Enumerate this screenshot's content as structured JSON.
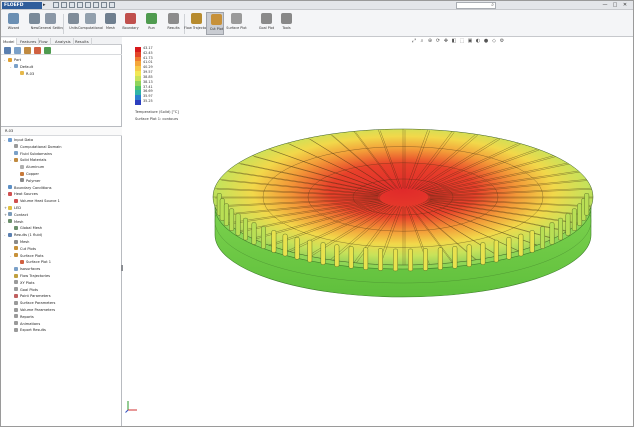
{
  "app": {
    "logo_text": "FLOEFD",
    "file_title": "",
    "window_controls": [
      "—",
      "□",
      "✕"
    ]
  },
  "ribbon": {
    "buttons": [
      {
        "label": "Wizard",
        "icon": "wizard-icon",
        "color": "#6b8fb3"
      },
      {
        "label": "New",
        "icon": "new-file-icon",
        "color": "#7a8a99"
      },
      {
        "label": "General Settings",
        "icon": "settings-icon",
        "color": "#8a97a6"
      },
      {
        "label": "Units",
        "icon": "units-icon",
        "color": "#7f8c99"
      },
      {
        "label": "Computational Domain",
        "icon": "domain-icon",
        "color": "#92a0ad"
      },
      {
        "label": "Mesh",
        "icon": "mesh-icon",
        "color": "#6f7f8f"
      },
      {
        "label": "Boundary",
        "icon": "boundary-icon",
        "color": "#c0504d"
      },
      {
        "label": "Run",
        "icon": "run-icon",
        "color": "#4f9b4f"
      },
      {
        "label": "Results",
        "icon": "results-icon",
        "color": "#8c8c8c"
      },
      {
        "label": "Flow Trajectories",
        "icon": "flow-trajectories-icon",
        "color": "#b78b2e"
      },
      {
        "label": "Cut Plot",
        "icon": "cut-plot-icon",
        "color": "#c7913a"
      },
      {
        "label": "Surface Plot",
        "icon": "surface-plot-icon",
        "color": "#9a9a9a"
      },
      {
        "label": "Goal Plot",
        "icon": "goal-plot-icon",
        "color": "#8a8a8a"
      },
      {
        "label": "Tools",
        "icon": "tools-icon",
        "color": "#888888"
      }
    ]
  },
  "sidebar": {
    "tabs": [
      "Model",
      "Features",
      "Flow",
      "Analysis",
      "Results"
    ],
    "tree1": [
      {
        "label": "Part",
        "level": 0,
        "icon_color": "#e0a030",
        "exp": "-"
      },
      {
        "label": "Default",
        "level": 1,
        "icon_color": "#7aa0c8",
        "exp": "-"
      },
      {
        "label": "R-03",
        "level": 2,
        "icon_color": "#e6b84a",
        "exp": ""
      }
    ],
    "tree2_header": "R-03",
    "tree2": [
      {
        "label": "Input Data",
        "level": 0,
        "icon_color": "#6b9bd1",
        "exp": "-"
      },
      {
        "label": "Computational Domain",
        "level": 1,
        "icon_color": "#9a9a9a",
        "exp": ""
      },
      {
        "label": "Fluid Subdomains",
        "level": 1,
        "icon_color": "#7aa0c8",
        "exp": ""
      },
      {
        "label": "Solid Materials",
        "level": 1,
        "icon_color": "#c08a40",
        "exp": "-"
      },
      {
        "label": "Aluminum",
        "level": 2,
        "icon_color": "#b0b0b0",
        "exp": ""
      },
      {
        "label": "Copper",
        "level": 2,
        "icon_color": "#c87a3a",
        "exp": ""
      },
      {
        "label": "Polymer",
        "level": 2,
        "icon_color": "#8a8a8a",
        "exp": ""
      },
      {
        "label": "Boundary Conditions",
        "level": 0,
        "icon_color": "#5c8fc5",
        "exp": ""
      },
      {
        "label": "Heat Sources",
        "level": 0,
        "icon_color": "#d05050",
        "exp": "-"
      },
      {
        "label": "Volume Heat Source 1",
        "level": 1,
        "icon_color": "#d05050",
        "exp": ""
      },
      {
        "label": "LED",
        "level": 0,
        "icon_color": "#e0c040",
        "exp": "+"
      },
      {
        "label": "Contact",
        "level": 0,
        "icon_color": "#7a9ab8",
        "exp": "+"
      },
      {
        "label": "Mesh",
        "level": 0,
        "icon_color": "#6a8f6a",
        "exp": "-"
      },
      {
        "label": "Global Mesh",
        "level": 1,
        "icon_color": "#6a8f6a",
        "exp": ""
      },
      {
        "label": "Results (1 fluid)",
        "level": 0,
        "icon_color": "#5a7fb0",
        "exp": "-"
      },
      {
        "label": "Mesh",
        "level": 1,
        "icon_color": "#8a8a8a",
        "exp": ""
      },
      {
        "label": "Cut Plots",
        "level": 1,
        "icon_color": "#c7913a",
        "exp": ""
      },
      {
        "label": "Surface Plots",
        "level": 1,
        "icon_color": "#c7913a",
        "exp": "-"
      },
      {
        "label": "Surface Plot 1",
        "level": 2,
        "icon_color": "#d06040",
        "exp": ""
      },
      {
        "label": "Isosurfaces",
        "level": 1,
        "icon_color": "#7aa0c8",
        "exp": ""
      },
      {
        "label": "Flow Trajectories",
        "level": 1,
        "icon_color": "#c0a040",
        "exp": ""
      },
      {
        "label": "XY Plots",
        "level": 1,
        "icon_color": "#9a9a9a",
        "exp": ""
      },
      {
        "label": "Goal Plots",
        "level": 1,
        "icon_color": "#9a9a9a",
        "exp": ""
      },
      {
        "label": "Point Parameters",
        "level": 1,
        "icon_color": "#c06060",
        "exp": ""
      },
      {
        "label": "Surface Parameters",
        "level": 1,
        "icon_color": "#9a9a9a",
        "exp": ""
      },
      {
        "label": "Volume Parameters",
        "level": 1,
        "icon_color": "#9a9a9a",
        "exp": ""
      },
      {
        "label": "Reports",
        "level": 1,
        "icon_color": "#9a9a9a",
        "exp": ""
      },
      {
        "label": "Animations",
        "level": 1,
        "icon_color": "#9a9a9a",
        "exp": ""
      },
      {
        "label": "Export Results",
        "level": 1,
        "icon_color": "#9a9a9a",
        "exp": ""
      }
    ]
  },
  "viewport": {
    "legend": {
      "ticks": [
        "43.17",
        "42.45",
        "41.73",
        "41.01",
        "40.29",
        "39.57",
        "38.85",
        "38.13",
        "37.41",
        "36.69",
        "35.97",
        "35.25"
      ],
      "colors": [
        "#d7191c",
        "#e3452a",
        "#ee7a2f",
        "#f4a63a",
        "#f7c948",
        "#f2e755",
        "#c9e35a",
        "#8fd45b",
        "#4fc46a",
        "#2fb5a8",
        "#2a7fd0",
        "#2b3fbf"
      ],
      "quantity_label": "Temperature (Solid) [°C]",
      "plot_label": "Surface Plot 1: contours"
    },
    "toolbar_icons": [
      "zoom-fit-icon",
      "zoom-area-icon",
      "zoom-icon",
      "rotate-icon",
      "pan-icon",
      "section-icon",
      "view-orient-icon",
      "display-style-icon",
      "hide-show-icon",
      "appearance-icon",
      "scene-icon",
      "settings-icon"
    ]
  }
}
